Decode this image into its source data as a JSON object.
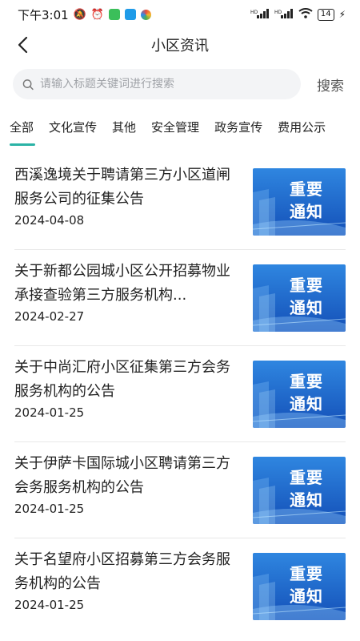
{
  "status_bar": {
    "time": "下午3:01",
    "battery": "14"
  },
  "nav": {
    "title": "小区资讯"
  },
  "search": {
    "placeholder": "请输入标题关键词进行搜索",
    "button_label": "搜索"
  },
  "tabs": [
    {
      "label": "全部",
      "active": true
    },
    {
      "label": "文化宣传",
      "active": false
    },
    {
      "label": "其他",
      "active": false
    },
    {
      "label": "安全管理",
      "active": false
    },
    {
      "label": "政务宣传",
      "active": false
    },
    {
      "label": "费用公示",
      "active": false
    }
  ],
  "thumb": {
    "line1": "重要",
    "line2": "通知"
  },
  "colors": {
    "accent": "#2bb3a6",
    "thumb_bg": "#1b63c9"
  },
  "news": [
    {
      "title": "西溪逸境关于聘请第三方小区道闸服务公司的征集公告",
      "date": "2024-04-08"
    },
    {
      "title": "关于新都公园城小区公开招募物业承接查验第三方服务机构...",
      "date": "2024-02-27"
    },
    {
      "title": "关于中尚汇府小区征集第三方会务服务机构的公告",
      "date": "2024-01-25"
    },
    {
      "title": "关于伊萨卡国际城小区聘请第三方会务服务机构的公告",
      "date": "2024-01-25"
    },
    {
      "title": "关于名望府小区招募第三方会务服务机构的公告",
      "date": "2024-01-25"
    }
  ]
}
